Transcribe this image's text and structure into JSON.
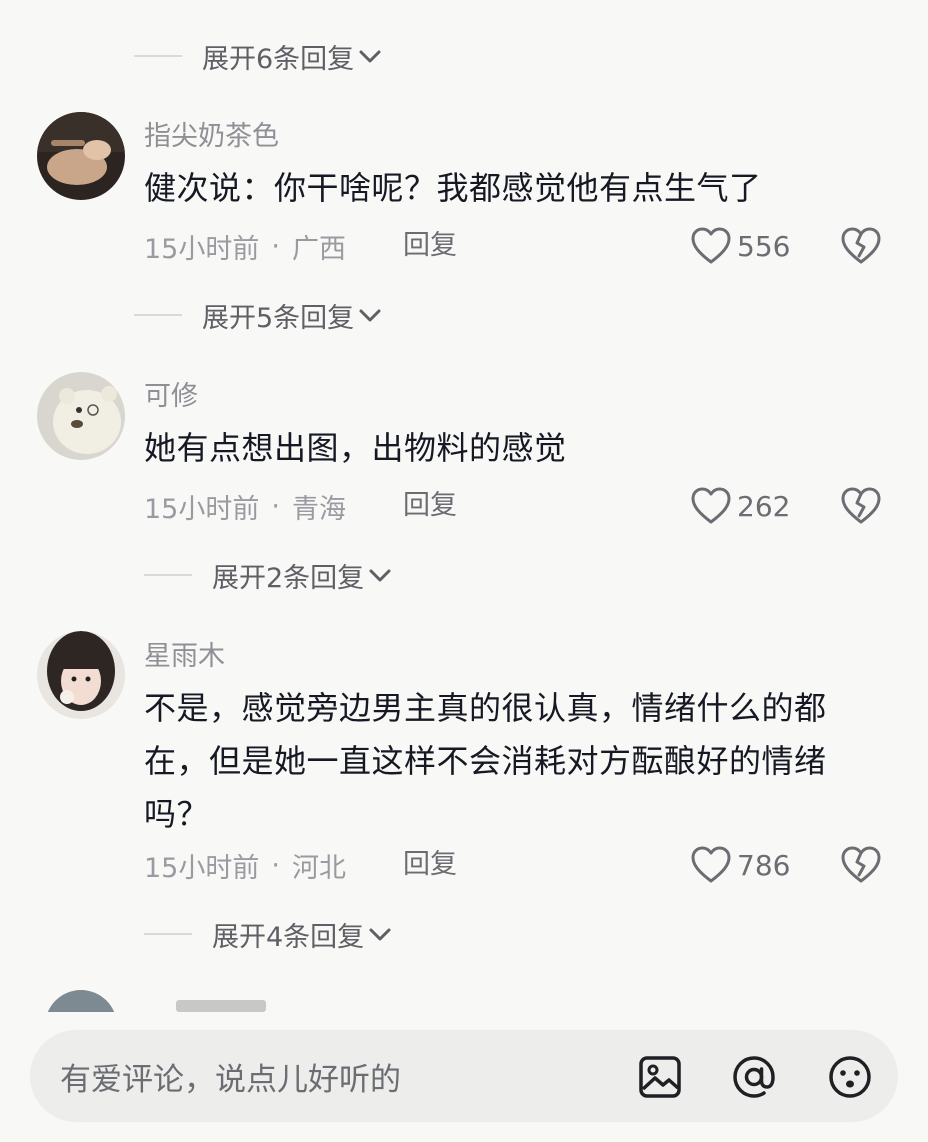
{
  "comments": [
    {
      "username": "指尖奶茶色",
      "text": "健次说：你干啥呢？我都感觉他有点生气了",
      "time": "15小时前",
      "location": "广西",
      "reply": "回复",
      "likes": "556",
      "expand": "展开5条回复"
    },
    {
      "username": "可修",
      "text": "她有点想出图，出物料的感觉",
      "time": "15小时前",
      "location": "青海",
      "reply": "回复",
      "likes": "262",
      "expand": "展开2条回复"
    },
    {
      "username": "星雨木",
      "text_lines": [
        "不是，感觉旁边男主真的很认真，情绪什么的都",
        "在，但是她一直这样不会消耗对方酝酿好的情绪",
        "吗？"
      ],
      "time": "15小时前",
      "location": "河北",
      "reply": "回复",
      "likes": "786",
      "expand": "展开4条回复"
    }
  ],
  "top_expand": "展开6条回复",
  "dot": "·",
  "input": {
    "placeholder": "有爱评论，说点儿好听的",
    "icons": [
      "image-icon",
      "at-icon",
      "emoji-icon"
    ]
  },
  "colors": {
    "background": "#f8f8f6",
    "text": "#161823",
    "secondary": "#9a9ba1",
    "input_bg": "#ededeb"
  }
}
